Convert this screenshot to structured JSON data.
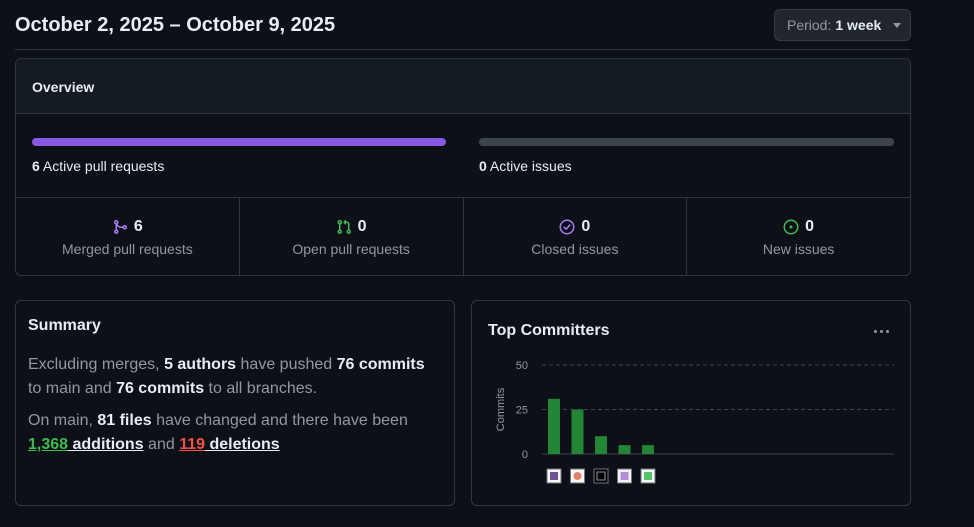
{
  "header": {
    "title": "October 2, 2025 – October 9, 2025",
    "period_label": "Period:",
    "period_value": "1 week"
  },
  "overview": {
    "title": "Overview",
    "active_prs_count": "6",
    "active_prs_label": "Active pull requests",
    "active_prs_fraction": 1.0,
    "active_issues_count": "0",
    "active_issues_label": "Active issues",
    "active_issues_fraction": 0,
    "stats": [
      {
        "count": "6",
        "label": "Merged pull requests",
        "icon": "git-merge-icon",
        "color": "#ab7df8"
      },
      {
        "count": "0",
        "label": "Open pull requests",
        "icon": "git-pull-request-icon",
        "color": "#3fb950"
      },
      {
        "count": "0",
        "label": "Closed issues",
        "icon": "issue-closed-icon",
        "color": "#ab7df8"
      },
      {
        "count": "0",
        "label": "New issues",
        "icon": "issue-opened-icon",
        "color": "#3fb950"
      }
    ]
  },
  "summary": {
    "title": "Summary",
    "p1_a": "Excluding merges, ",
    "p1_authors": "5 authors",
    "p1_b": " have pushed ",
    "p1_commits_main": "76 commits",
    "p1_c": " to main and ",
    "p1_commits_all": "76 commits",
    "p1_d": " to all branches.",
    "p2_a": "On main, ",
    "p2_files": "81 files",
    "p2_b": " have changed and there have been ",
    "p2_additions_num": "1,368",
    "p2_additions_word": " additions",
    "p2_c": " and ",
    "p2_deletions_num": "119",
    "p2_deletions_word": " deletions"
  },
  "committers": {
    "title": "Top Committers"
  },
  "chart_data": {
    "type": "bar",
    "title": "Top Committers",
    "ylabel": "Commits",
    "xlabel": "",
    "ylim": [
      0,
      50
    ],
    "yticks": [
      "0",
      "25",
      "50"
    ],
    "values": [
      31,
      25,
      10,
      5,
      5
    ],
    "bar_color": "#238636",
    "grid": "dashed horizontal",
    "categories": [
      "committer-avatar-1",
      "committer-avatar-2",
      "committer-avatar-3",
      "committer-avatar-4",
      "committer-avatar-5"
    ],
    "avatar_colors": [
      "#6e5494",
      "#e0826a",
      "#1b1f24",
      "#b48ed6",
      "#52c46a"
    ]
  }
}
